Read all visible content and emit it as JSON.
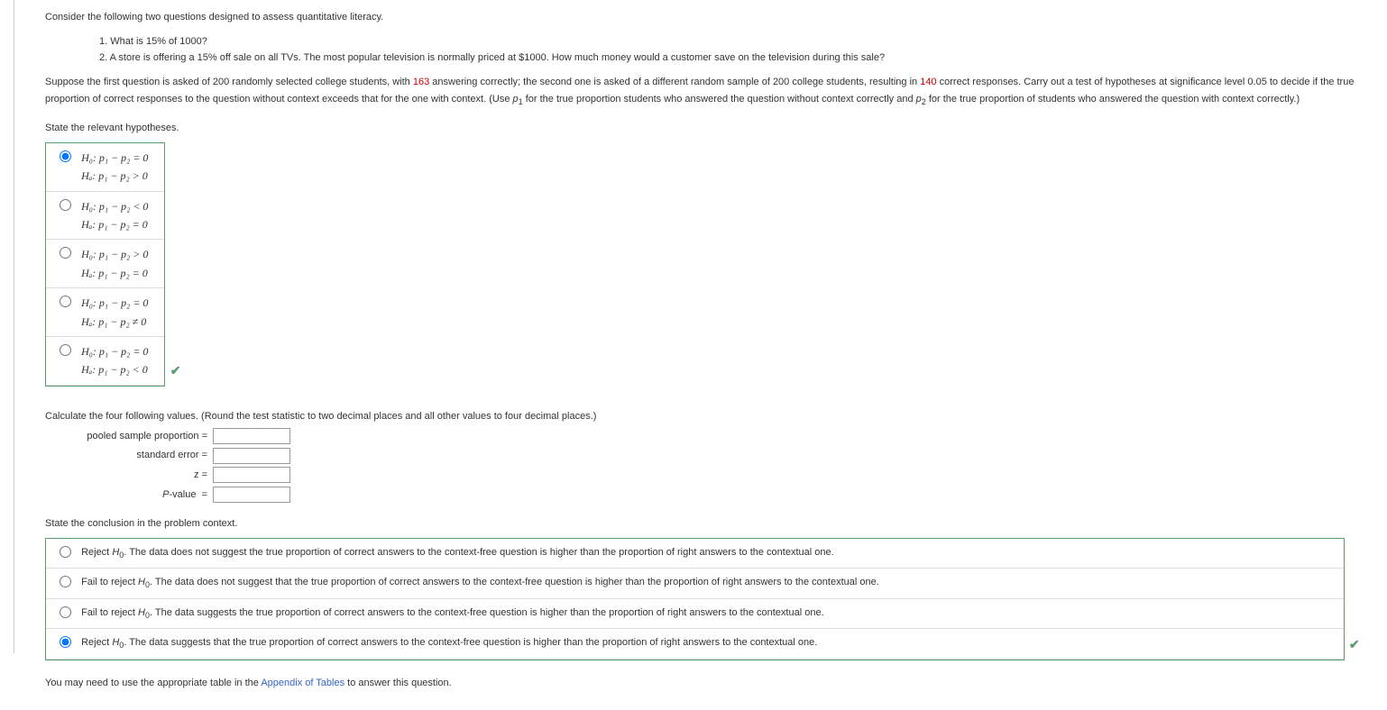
{
  "intro": "Consider the following two questions designed to assess quantitative literacy.",
  "q1": "1. What is 15% of 1000?",
  "q2": "2. A store is offering a 15% off sale on all TVs. The most popular television is normally priced at $1000. How much money would a customer save on the television during this sale?",
  "para1a": "Suppose the first question is asked of 200 randomly selected college students, with ",
  "n1": "163",
  "para1b": " answering correctly; the second one is asked of a different random sample of 200 college students, resulting in ",
  "n2": "140",
  "para1c": " correct responses. Carry out a test of hypotheses at significance level 0.05 to decide if the true proportion of correct responses to the question without context exceeds that for the one with context. (Use ",
  "p1": "p",
  "p1_sub": "1",
  "para1d": " for the true proportion students who answered the question without context correctly and ",
  "p2": "p",
  "p2_sub": "2",
  "para1e": " for the true proportion of students who answered the question with context correctly.)",
  "state_hyp": "State the relevant hypotheses.",
  "hyp": {
    "o1a": "H₀: p₁ − p₂ = 0",
    "o1b": "Hₐ: p₁ − p₂ > 0",
    "o2a": "H₀: p₁ − p₂ < 0",
    "o2b": "Hₐ: p₁ − p₂ = 0",
    "o3a": "H₀: p₁ − p₂ > 0",
    "o3b": "Hₐ: p₁ − p₂ = 0",
    "o4a": "H₀: p₁ − p₂ = 0",
    "o4b": "Hₐ: p₁ − p₂ ≠ 0",
    "o5a": "H₀: p₁ − p₂ = 0",
    "o5b": "Hₐ: p₁ − p₂ < 0"
  },
  "calc_intro": "Calculate the four following values. (Round the test statistic to two decimal places and all other values to four decimal places.)",
  "calc": {
    "l1": "pooled sample proportion  =",
    "l2": "standard error  =",
    "l3": "z  =",
    "l4": "P-value  ="
  },
  "conc_intro": "State the conclusion in the problem context.",
  "conc": {
    "c1a": "Reject ",
    "c1b": ". The data does not suggest the true proportion of correct answers to the context-free question is higher than the proportion of right answers to the contextual one.",
    "c2a": "Fail to reject ",
    "c2b": ". The data does not suggest that the true proportion of correct answers to the context-free question is higher than the proportion of right answers to the contextual one.",
    "c3a": "Fail to reject ",
    "c3b": ". The data suggests the true proportion of correct answers to the context-free question is higher than the proportion of right answers to the contextual one.",
    "c4a": "Reject ",
    "c4b": ". The data suggests that the true proportion of correct answers to the context-free question is higher than the proportion of right answers to the contextual one."
  },
  "H0": "H",
  "H0_sub": "0",
  "footer_a": "You may need to use the appropriate table in the ",
  "footer_link": "Appendix of Tables",
  "footer_b": " to answer this question."
}
